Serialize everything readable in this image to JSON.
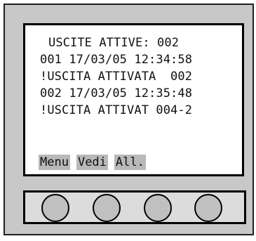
{
  "display": {
    "lines": [
      "USCITE ATTIVE: 002",
      "001 17/03/05 12:34:58",
      "!USCITA ATTIVATA  002",
      "002 17/03/05 12:35:48",
      "!USCITA ATTIVAT 004-2"
    ],
    "softkeys": [
      "Menu",
      "Vedi",
      "All."
    ]
  },
  "colors": {
    "panel": "#c8c8c8",
    "screen": "#ffffff",
    "softkey_bg": "#b9b9b9",
    "button": "#c0c0c0"
  },
  "buttons": [
    {
      "name": "function-button-1"
    },
    {
      "name": "function-button-2"
    },
    {
      "name": "function-button-3"
    },
    {
      "name": "function-button-4"
    }
  ]
}
